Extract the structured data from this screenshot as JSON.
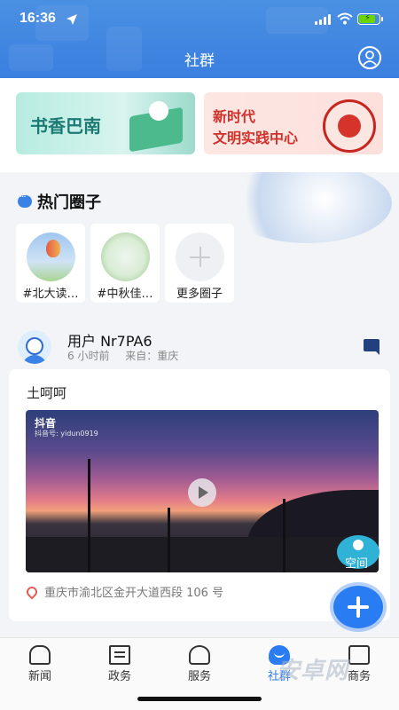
{
  "status_bar": {
    "time": "16:36"
  },
  "header": {
    "title": "社群"
  },
  "banners": [
    {
      "text": "书香巴南"
    },
    {
      "line1": "新时代",
      "line2": "文明实践中心"
    }
  ],
  "hot_circles": {
    "title": "热门圈子",
    "items": [
      {
        "label": "#北大读…"
      },
      {
        "label": "#中秋佳…"
      },
      {
        "label": "更多圈子"
      }
    ]
  },
  "post": {
    "username": "用户 Nr7PA6",
    "time": "6 小时前",
    "source": "来自：重庆",
    "text": "土呵呵",
    "video_brand": "抖音",
    "video_id": "抖音号: yidun0919",
    "address": "重庆市渝北区金开大道西段 106 号"
  },
  "fab": {
    "space_label": "空间"
  },
  "tabbar": {
    "items": [
      {
        "label": "新闻"
      },
      {
        "label": "政务"
      },
      {
        "label": "服务"
      },
      {
        "label": "社群"
      },
      {
        "label": "商务"
      }
    ],
    "active": "社群"
  },
  "watermark": "安卓网",
  "colors": {
    "primary": "#2a7cf2",
    "header": "#4a90e2",
    "address_pin": "#e25b57"
  }
}
